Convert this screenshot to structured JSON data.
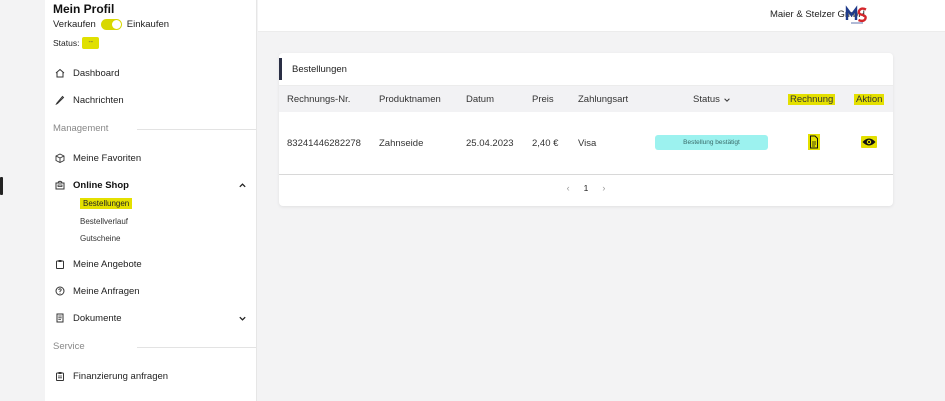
{
  "profile": {
    "title": "Mein Profil",
    "mode_left": "Verkaufen",
    "mode_right": "Einkaufen",
    "status_label": "Status:",
    "status_value": "--"
  },
  "sidebar": {
    "items": [
      {
        "label": "Dashboard",
        "icon": "home-icon"
      },
      {
        "label": "Nachrichten",
        "icon": "pen-icon"
      },
      {
        "label": "Meine Favoriten",
        "icon": "box-icon"
      },
      {
        "label": "Online Shop",
        "icon": "shop-icon"
      },
      {
        "label": "Meine Angebote",
        "icon": "clipboard-icon"
      },
      {
        "label": "Meine Anfragen",
        "icon": "help-circle-icon"
      },
      {
        "label": "Dokumente",
        "icon": "document-icon"
      },
      {
        "label": "Finanzierung anfragen",
        "icon": "clipboard-icon"
      }
    ],
    "sections": {
      "management": "Management",
      "service": "Service"
    },
    "online_shop_sub": [
      "Bestellungen",
      "Bestellverlauf",
      "Gutscheine"
    ]
  },
  "topbar": {
    "company": "Maier & Stelzer GmbH"
  },
  "orders": {
    "title": "Bestellungen",
    "columns": [
      "Rechnungs-Nr.",
      "Produktnamen",
      "Datum",
      "Preis",
      "Zahlungsart",
      "Status",
      "Rechnung",
      "Aktion"
    ],
    "rows": [
      {
        "invoice": "83241446282278",
        "product": "Zahnseide",
        "date": "25.04.2023",
        "price": "2,40 €",
        "payment": "Visa",
        "status": "Bestellung bestätigt"
      }
    ],
    "pagination": {
      "prev": "‹",
      "page": "1",
      "next": "›"
    }
  },
  "colors": {
    "highlight": "#e4e000",
    "status_pill": "#9cf2ef",
    "accent": "#2a2f45"
  }
}
